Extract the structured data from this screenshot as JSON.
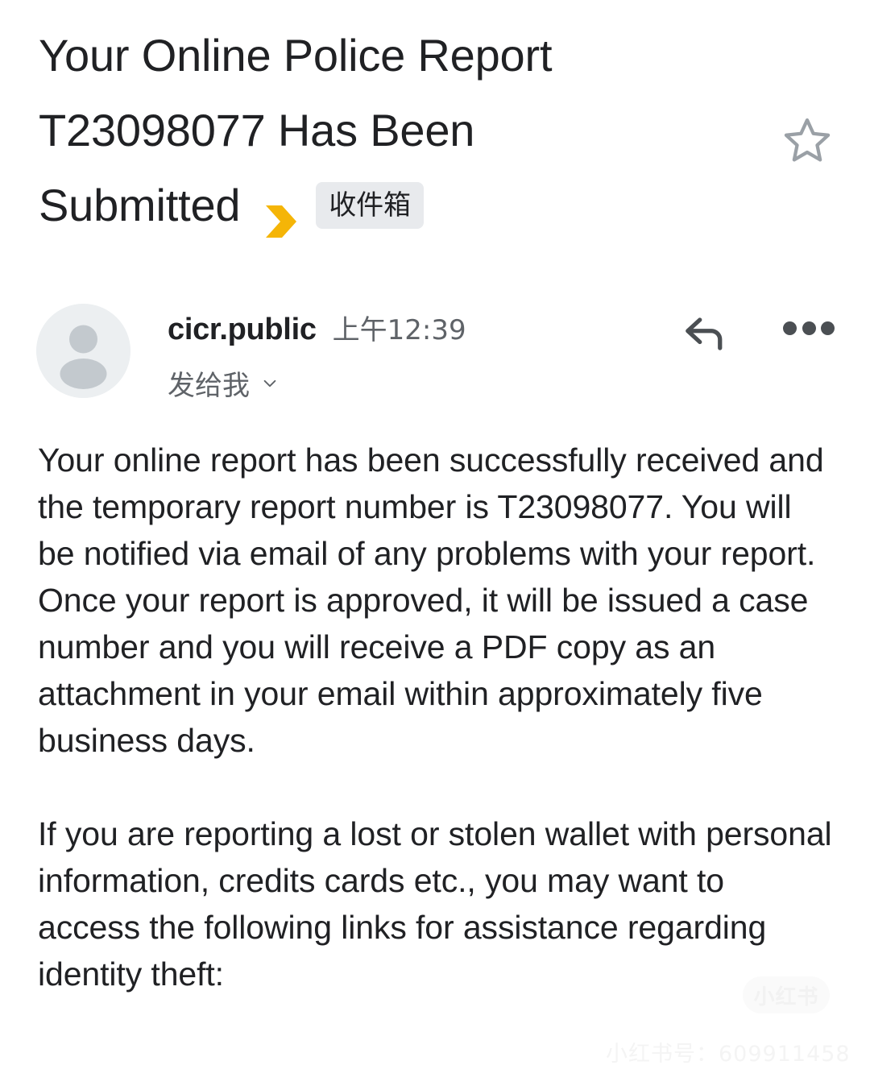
{
  "email": {
    "subject_lines": [
      "Your Online Police Report",
      "T23098077 Has Been",
      "Submitted"
    ],
    "subject_full": "Your Online Police Report T23098077 Has Been Submitted",
    "important_marker_icon": "yellow-chevron-important-icon",
    "important_marker_color": "#f5b507",
    "label_chip": "收件箱",
    "label_chip_bg": "#e8eaed",
    "star": {
      "icon": "star-outline-icon",
      "state": "not-starred",
      "color": "#9aa0a6"
    },
    "sender": {
      "name": "cicr.public",
      "time": "上午12:39",
      "recipient_label": "发给我",
      "expand_icon": "chevron-down-icon",
      "avatar_icon": "person-avatar-icon"
    },
    "actions": {
      "reply_icon": "reply-arrow-icon",
      "more_icon": "more-options-icon"
    },
    "body_paragraphs": [
      "Your online report has been successfully received and the temporary report number is T23098077. You will be notified via email of any problems with your report. Once your report is approved, it will be issued a case number and you will receive a PDF copy as an attachment in your email within approximately five business days.",
      "If you are reporting a lost or stolen wallet with personal information, credits cards etc., you may want to access the following links for assistance regarding identity theft:"
    ]
  },
  "watermark": {
    "logo_text": "小红书",
    "id_text": "小红书号：609911458"
  }
}
